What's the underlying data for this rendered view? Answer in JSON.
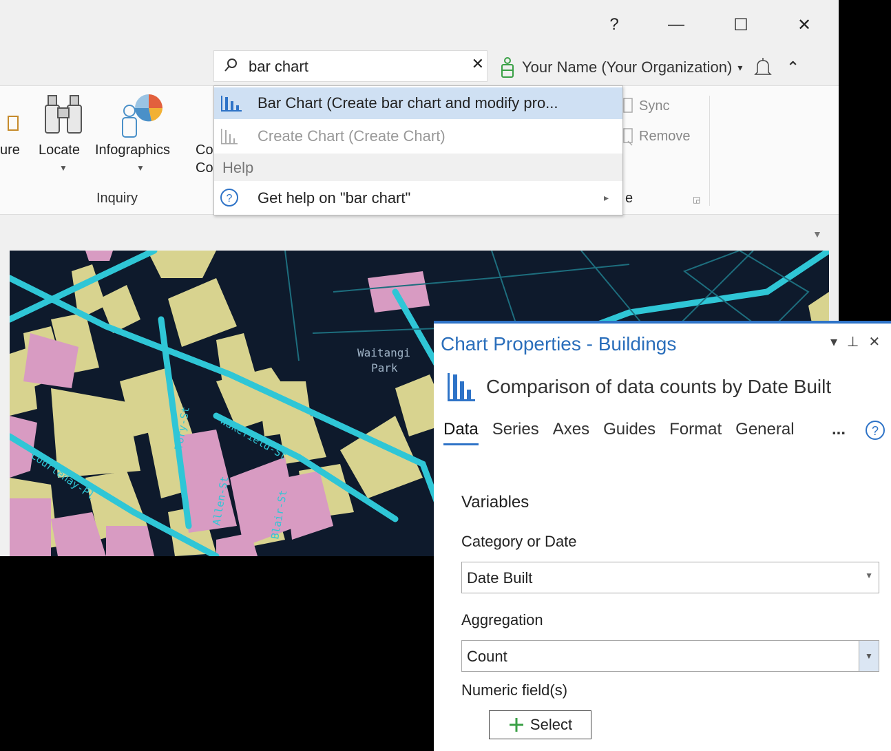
{
  "window": {
    "help_label": "?",
    "minimize_label": "—",
    "maximize_label": "☐",
    "close_label": "✕"
  },
  "search": {
    "value": "bar chart",
    "clear_label": "✕"
  },
  "user": {
    "name": "Your Name (Your Organization)",
    "caret": "▾",
    "collapse_label": "⌃"
  },
  "ribbon": {
    "partial_left_label": "ure",
    "locate_label": "Locate",
    "infographics_label": "Infographics",
    "partial_co1": "Co",
    "partial_co2": "Co",
    "group_label": "Inquiry",
    "sync_label": "Sync",
    "remove_label": "Remove",
    "partial_e": "e"
  },
  "dropdown": {
    "items": [
      {
        "label": "Bar Chart (Create bar chart and modify pro..."
      },
      {
        "label": "Create Chart (Create Chart)"
      }
    ],
    "help_header": "Help",
    "help_item": "Get help on  \"bar chart\"",
    "submenu_arrow": "▸"
  },
  "map": {
    "labels": [
      "Waitangi",
      "Park",
      "Tory-St",
      "Wakefield-St",
      "Courtenay-Pl",
      "Allen-St",
      "Blair-St"
    ]
  },
  "pane": {
    "title": "Chart Properties - Buildings",
    "controls": [
      "▾",
      "⊥",
      "✕"
    ],
    "chart_title": "Comparison of data counts by Date Built",
    "tabs": [
      "Data",
      "Series",
      "Axes",
      "Guides",
      "Format",
      "General"
    ],
    "more_label": "...",
    "variables_heading": "Variables",
    "category_label": "Category or Date",
    "category_value": "Date Built",
    "aggregation_label": "Aggregation",
    "aggregation_value": "Count",
    "numeric_label": "Numeric field(s)",
    "select_label": "Select"
  },
  "colors": {
    "accent": "#2e73c7",
    "map_background": "#0e1a2c",
    "building_yellow": "#d8d38f",
    "building_pink": "#d89bc2",
    "road_cyan": "#2fc6d6"
  }
}
